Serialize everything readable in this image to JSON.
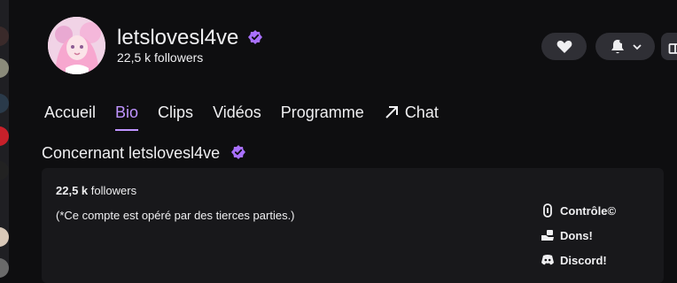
{
  "channel": {
    "name": "letslovesl4ve",
    "followers_count": "22,5 k",
    "followers_label": "followers"
  },
  "tabs": [
    {
      "label": "Accueil"
    },
    {
      "label": "Bio"
    },
    {
      "label": "Clips"
    },
    {
      "label": "Vidéos"
    },
    {
      "label": "Programme"
    },
    {
      "label": "Chat"
    }
  ],
  "about": {
    "title": "Concernant letslovesl4ve",
    "followers_count": "22,5 k",
    "followers_label": "followers",
    "description": "(*Ce compte est opéré par des tierces parties.)",
    "links": [
      {
        "label": "Contrôle©",
        "icon": "link-icon"
      },
      {
        "label": "Dons!",
        "icon": "donation-icon"
      },
      {
        "label": "Discord!",
        "icon": "discord-icon"
      }
    ]
  },
  "colors": {
    "accent": "#bf94ff",
    "verified": "#a970ff",
    "background": "#0e0e10",
    "panel": "#18181b",
    "button": "#2f2f35"
  }
}
